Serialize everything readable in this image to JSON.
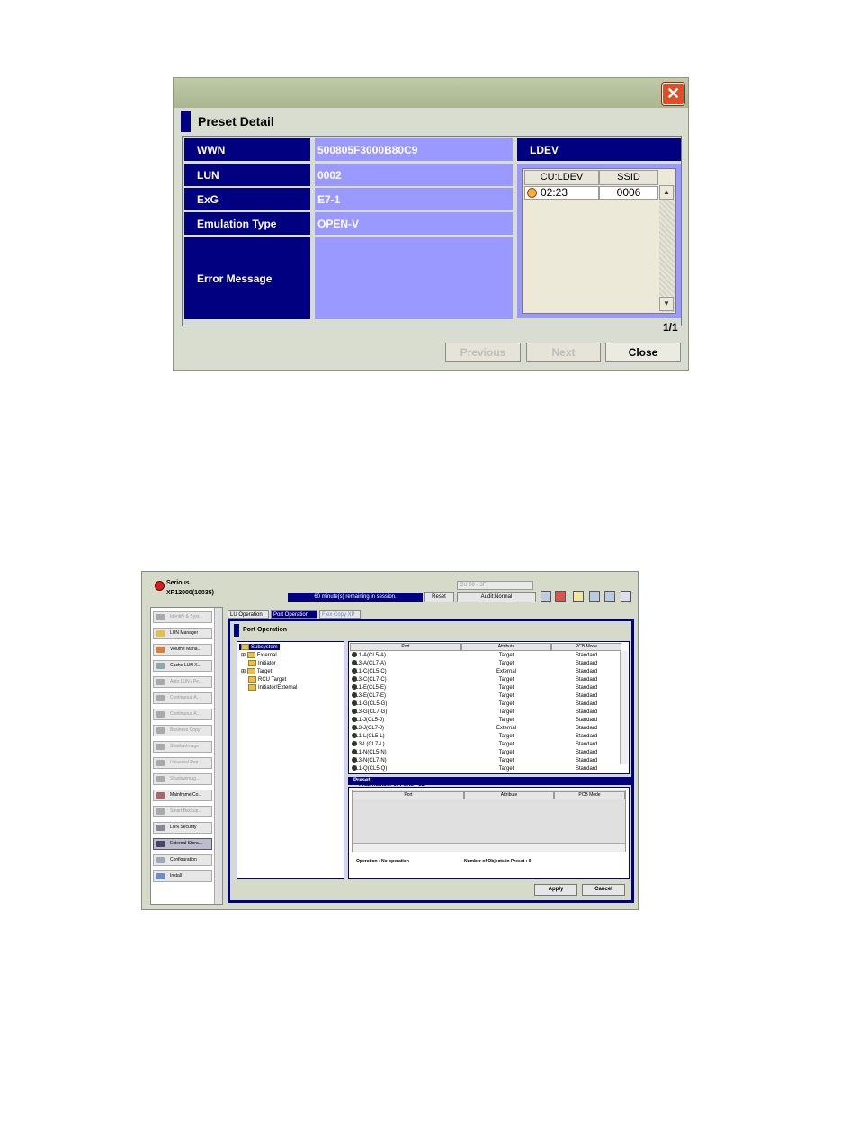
{
  "preset_dialog": {
    "title": "Preset Detail",
    "close_icon": "close-icon",
    "fields": [
      {
        "label": "WWN",
        "value": "500805F3000B80C9"
      },
      {
        "label": "LUN",
        "value": "0002"
      },
      {
        "label": "ExG",
        "value": "E7-1"
      },
      {
        "label": "Emulation Type",
        "value": "OPEN-V"
      },
      {
        "label": "Error Message",
        "value": ""
      }
    ],
    "ldev": {
      "header": "LDEV",
      "columns": [
        "CU:LDEV",
        "SSID"
      ],
      "rows": [
        {
          "cu_ldev": "02:23",
          "ssid": "0006"
        }
      ]
    },
    "pager": "1/1",
    "buttons": {
      "previous": "Previous",
      "next": "Next",
      "close": "Close"
    }
  },
  "app": {
    "status": "Serious",
    "system_id": "XP12000(10035)",
    "cu_select": "CU 00 - 3F",
    "session_text": "60 minute(s) remaining in session.",
    "reset_label": "Reset",
    "audit_label": "Audit:Normal",
    "left_menu": [
      "Identify & Syst...",
      "LUN Manager",
      "Volume Mana...",
      "Cache LUN X...",
      "Auto LUN / Pe...",
      "Continuous A...",
      "Continuous A...",
      "Business Copy",
      "ShadowImage",
      "Universal Rep...",
      "Shadowimag...",
      "Mainframe Co...",
      "Smart Backup...",
      "LUN Security",
      "External Stora...",
      "Configuration",
      "Install"
    ],
    "tabs": [
      "LU Operation",
      "Port Operation",
      "Flex Copy XP"
    ],
    "panel_title": "Port Operation",
    "tree": [
      "Subsystem",
      "External",
      "Initiator",
      "Target",
      "RCU Target",
      "Initiator/External"
    ],
    "port_table": {
      "columns": [
        "Port",
        "Attribute",
        "PCB Mode"
      ],
      "rows": [
        [
          "CL1-A(CL5-A)",
          "Target",
          "Standard"
        ],
        [
          "CL3-A(CL7-A)",
          "Target",
          "Standard"
        ],
        [
          "CL1-C(CL5-C)",
          "External",
          "Standard"
        ],
        [
          "CL3-C(CL7-C)",
          "Target",
          "Standard"
        ],
        [
          "CL1-E(CL5-E)",
          "Target",
          "Standard"
        ],
        [
          "CL3-E(CL7-E)",
          "Target",
          "Standard"
        ],
        [
          "CL1-G(CL5-G)",
          "Target",
          "Standard"
        ],
        [
          "CL3-G(CL7-G)",
          "Target",
          "Standard"
        ],
        [
          "CL1-J(CL5-J)",
          "Target",
          "Standard"
        ],
        [
          "CL3-J(CL7-J)",
          "External",
          "Standard"
        ],
        [
          "CL1-L(CL5-L)",
          "Target",
          "Standard"
        ],
        [
          "CL3-L(CL7-L)",
          "Target",
          "Standard"
        ],
        [
          "CL1-N(CL5-N)",
          "Target",
          "Standard"
        ],
        [
          "CL3-N(CL7-N)",
          "Target",
          "Standard"
        ],
        [
          "CL1-Q(CL5-Q)",
          "Target",
          "Standard"
        ]
      ],
      "total": "Total number of Ports :  32"
    },
    "preset": {
      "header": "Preset",
      "columns": [
        "Port",
        "Attribute",
        "PCB Mode"
      ],
      "operation": "Operation :  No operation",
      "count": "Number of Objects in Preset :  0"
    },
    "buttons": {
      "apply": "Apply",
      "cancel": "Cancel"
    }
  }
}
